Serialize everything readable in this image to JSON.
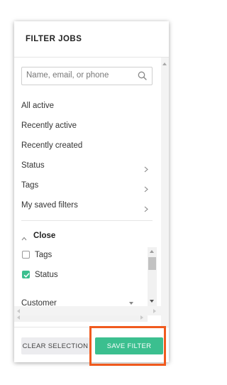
{
  "panel": {
    "title": "FILTER JOBS"
  },
  "search": {
    "placeholder": "Name, email, or phone",
    "value": "",
    "icon": "search-icon"
  },
  "nav_items": [
    {
      "label": "All active",
      "has_chevron": false
    },
    {
      "label": "Recently active",
      "has_chevron": false
    },
    {
      "label": "Recently created",
      "has_chevron": false
    },
    {
      "label": "Status",
      "has_chevron": true
    },
    {
      "label": "Tags",
      "has_chevron": true
    },
    {
      "label": "My saved filters",
      "has_chevron": true
    }
  ],
  "close_section": {
    "label": "Close",
    "icon": "chevron-up-icon"
  },
  "options": [
    {
      "label": "Tags",
      "checked": false
    },
    {
      "label": "Status",
      "checked": true
    }
  ],
  "select": {
    "label": "Customer",
    "icon": "dropdown-arrow-icon"
  },
  "footer": {
    "clear_label": "CLEAR SELECTION",
    "save_label": "SAVE FILTER"
  },
  "colors": {
    "accent": "#3bbf8f",
    "highlight": "#f05a1e"
  }
}
